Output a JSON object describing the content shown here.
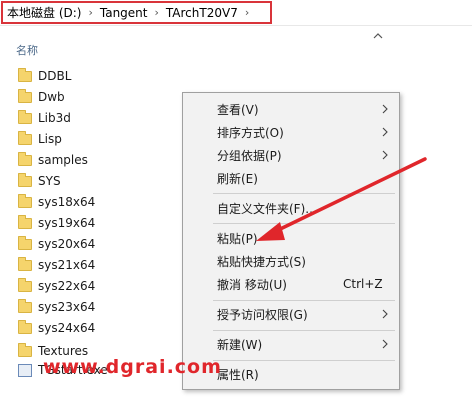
{
  "address": {
    "crumbs": [
      "本地磁盘 (D:)",
      "Tangent",
      "TArchT20V7"
    ],
    "separator": "›",
    "highlight_color": "#d9343a"
  },
  "list_header": {
    "name_label": "名称"
  },
  "files": [
    {
      "name": "DDBL",
      "type": "folder"
    },
    {
      "name": "Dwb",
      "type": "folder"
    },
    {
      "name": "Lib3d",
      "type": "folder"
    },
    {
      "name": "Lisp",
      "type": "folder"
    },
    {
      "name": "samples",
      "type": "folder"
    },
    {
      "name": "SYS",
      "type": "folder"
    },
    {
      "name": "sys18x64",
      "type": "folder"
    },
    {
      "name": "sys19x64",
      "type": "folder"
    },
    {
      "name": "sys20x64",
      "type": "folder"
    },
    {
      "name": "sys21x64",
      "type": "folder"
    },
    {
      "name": "sys22x64",
      "type": "folder"
    },
    {
      "name": "sys23x64",
      "type": "folder"
    },
    {
      "name": "sys24x64",
      "type": "folder"
    },
    {
      "name": "Textures",
      "type": "folder"
    },
    {
      "name": "TGstart.exe",
      "type": "exe"
    }
  ],
  "context_menu": {
    "items": [
      {
        "label": "查看(V)",
        "submenu": true
      },
      {
        "label": "排序方式(O)",
        "submenu": true
      },
      {
        "label": "分组依据(P)",
        "submenu": true
      },
      {
        "label": "刷新(E)",
        "submenu": false
      },
      {
        "label": "自定义文件夹(F)...",
        "submenu": false
      },
      {
        "label": "粘贴(P)",
        "submenu": false
      },
      {
        "label": "粘贴快捷方式(S)",
        "submenu": false
      },
      {
        "label": "撤消 移动(U)",
        "shortcut": "Ctrl+Z",
        "submenu": false
      },
      {
        "label": "授予访问权限(G)",
        "submenu": true
      },
      {
        "label": "新建(W)",
        "submenu": true
      },
      {
        "label": "属性(R)",
        "submenu": false
      }
    ]
  },
  "watermark": {
    "text": "www.dgrai.com",
    "color": "#e0262b"
  },
  "icons": {
    "collapse": "chevron-up-icon",
    "submenu": "chevron-right-icon",
    "folder": "folder-icon",
    "exe": "exe-file-icon"
  }
}
